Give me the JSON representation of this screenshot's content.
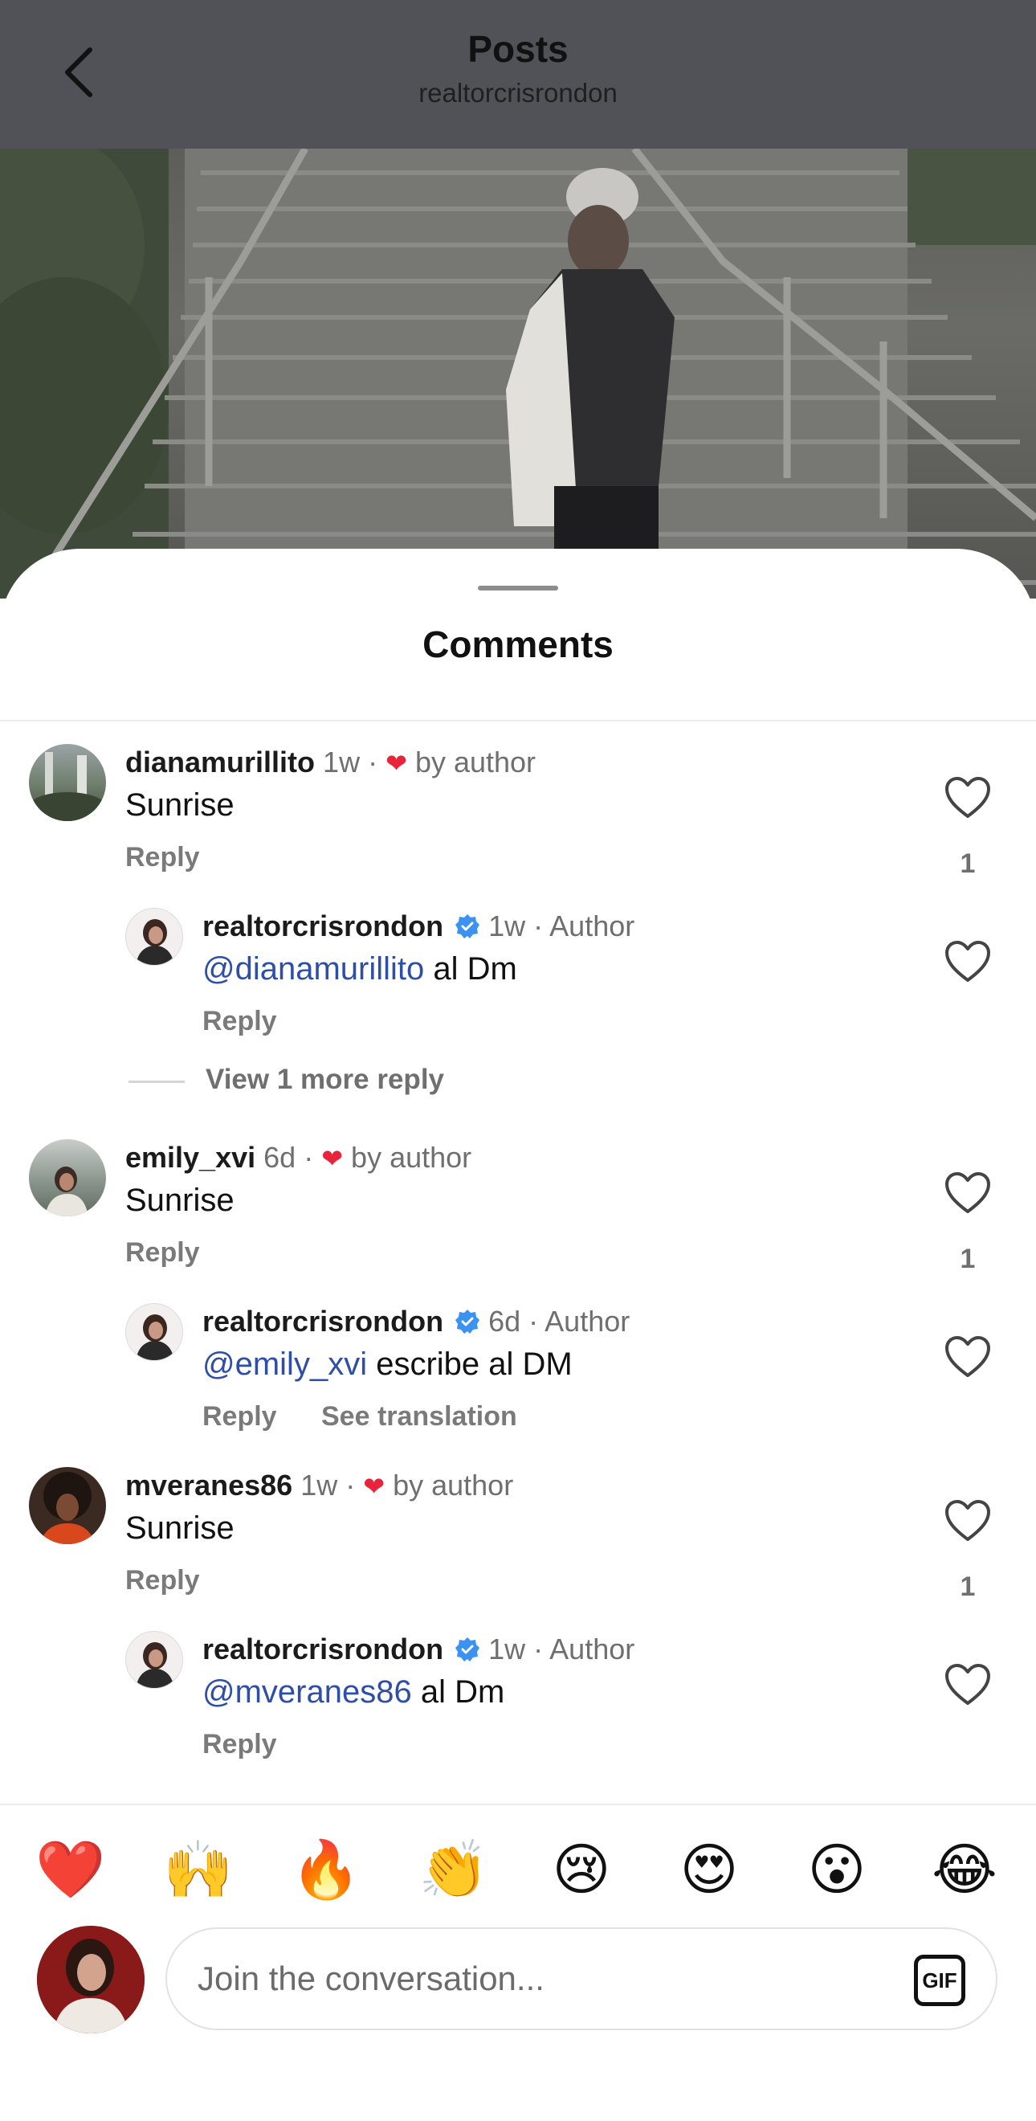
{
  "header": {
    "title": "Posts",
    "subtitle": "realtorcrisrondon",
    "back_icon": "chevron-left-icon"
  },
  "sheet": {
    "title": "Comments"
  },
  "comments": [
    {
      "user": "dianamurillito",
      "time": "1w",
      "dot": "·",
      "author_like": "by author",
      "text": "Sunrise",
      "reply": "Reply",
      "likes": "1",
      "replies": [
        {
          "user": "realtorcrisrondon",
          "time": "1w",
          "dot": "·",
          "badge": "Author",
          "mention": "@dianamurillito",
          "text": " al Dm",
          "reply": "Reply"
        }
      ],
      "view_more": "View 1 more reply"
    },
    {
      "user": "emily_xvi",
      "time": "6d",
      "dot": "·",
      "author_like": "by author",
      "text": "Sunrise",
      "reply": "Reply",
      "likes": "1",
      "replies": [
        {
          "user": "realtorcrisrondon",
          "time": "6d",
          "dot": "·",
          "badge": "Author",
          "mention": "@emily_xvi",
          "text": " escribe al DM",
          "reply": "Reply",
          "see_translation": "See translation"
        }
      ]
    },
    {
      "user": "mveranes86",
      "time": "1w",
      "dot": "·",
      "author_like": "by author",
      "text": "Sunrise",
      "reply": "Reply",
      "likes": "1",
      "replies": [
        {
          "user": "realtorcrisrondon",
          "time": "1w",
          "dot": "·",
          "badge": "Author",
          "mention": "@mveranes86",
          "text": " al Dm",
          "reply": "Reply"
        }
      ]
    }
  ],
  "emoji_bar": [
    "❤️",
    "🙌",
    "🔥",
    "👏",
    "😢",
    "😍",
    "😮",
    "😂"
  ],
  "composer": {
    "placeholder": "Join the conversation...",
    "gif_label": "GIF"
  },
  "colors": {
    "header_bg": "#505257",
    "mention": "#2f4ea8",
    "heart_red": "#e8243b",
    "verified_blue": "#3b92f0"
  }
}
